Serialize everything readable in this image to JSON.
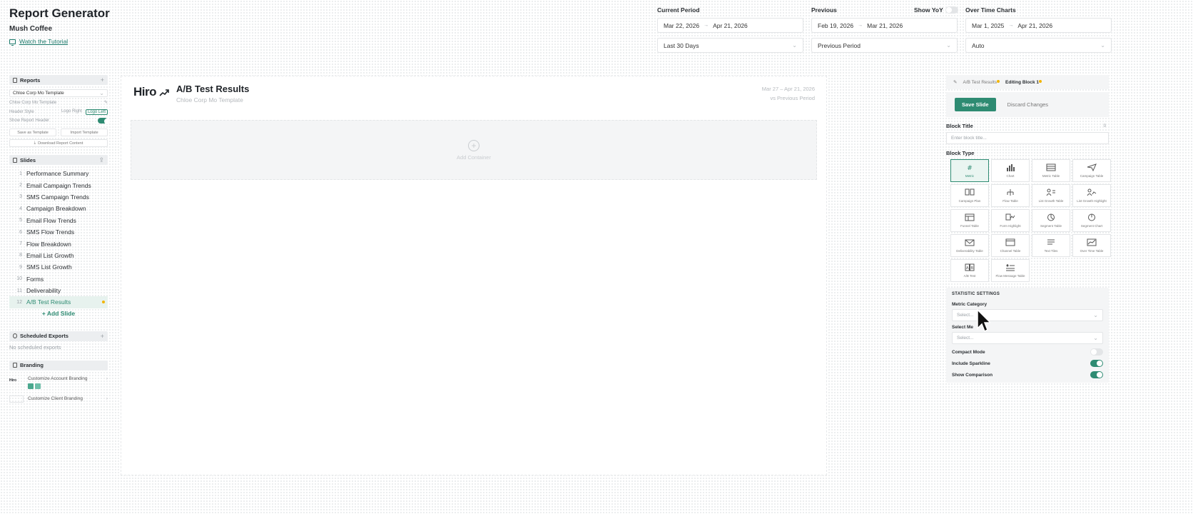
{
  "header": {
    "title": "Report Generator",
    "client": "Mush Coffee",
    "tutorial_link": "Watch the Tutorial"
  },
  "periods": {
    "current": {
      "label": "Current Period",
      "start": "Mar 22, 2026",
      "end": "Apr 21, 2026",
      "preset": "Last 30 Days"
    },
    "previous": {
      "label": "Previous",
      "yoy_label": "Show YoY",
      "yoy_on": false,
      "start": "Feb 19, 2026",
      "end": "Mar 21, 2026",
      "preset": "Previous Period"
    },
    "overtime": {
      "label": "Over Time Charts",
      "start": "Mar 1, 2025",
      "end": "Apr 21, 2026",
      "preset": "Auto"
    }
  },
  "sidebar": {
    "reports": {
      "title": "Reports",
      "template_select": "Chloe Corp Mo Template",
      "template_name": "Chloe Corp Mo Template",
      "header_style_label": "Header Style",
      "logo_right": "Logo Right",
      "logo_left": "Logo Left",
      "show_report_header_label": "Show Report Header",
      "save_template": "Save as Template",
      "import_template": "Import Template",
      "download": "Download Report Content"
    },
    "slides": {
      "title": "Slides",
      "items": [
        {
          "num": "1",
          "label": "Performance Summary"
        },
        {
          "num": "2",
          "label": "Email Campaign Trends"
        },
        {
          "num": "3",
          "label": "SMS Campaign Trends"
        },
        {
          "num": "4",
          "label": "Campaign Breakdown"
        },
        {
          "num": "5",
          "label": "Email Flow Trends"
        },
        {
          "num": "6",
          "label": "SMS Flow Trends"
        },
        {
          "num": "7",
          "label": "Flow Breakdown"
        },
        {
          "num": "8",
          "label": "Email List Growth"
        },
        {
          "num": "9",
          "label": "SMS List Growth"
        },
        {
          "num": "10",
          "label": "Forms"
        },
        {
          "num": "11",
          "label": "Deliverability"
        },
        {
          "num": "12",
          "label": "A/B Test Results"
        }
      ],
      "add_label": "+ Add Slide"
    },
    "scheduled": {
      "title": "Scheduled Exports",
      "empty": "No scheduled exports"
    },
    "branding": {
      "title": "Branding",
      "account": "Customize Account Branding",
      "client": "Customize Client Branding",
      "logo_text": "Hiro",
      "swatch_colors": [
        "#4aa88e",
        "#6fbfaa"
      ]
    }
  },
  "canvas": {
    "logo": "Hiro",
    "title": "A/B Test Results",
    "subtitle": "Chloe Corp Mo Template",
    "date_range": "Mar 27 – Apr 21, 2026",
    "comparison": "vs Previous Period",
    "add_container": "Add Container"
  },
  "editor": {
    "tab_slide": "A/B Test Results",
    "tab_block": "Editing Block 1",
    "save": "Save Slide",
    "discard": "Discard Changes",
    "block_title_label": "Block Title",
    "block_title_count": "0",
    "block_title_placeholder": "Enter block title...",
    "block_type_label": "Block Type",
    "block_types": [
      {
        "label": "Metric",
        "icon": "hash-icon"
      },
      {
        "label": "Chart",
        "icon": "bar-chart-icon"
      },
      {
        "label": "Metric Table",
        "icon": "table-icon"
      },
      {
        "label": "Campaign Table",
        "icon": "send-icon"
      },
      {
        "label": "Campaign Plan",
        "icon": "columns-icon"
      },
      {
        "label": "Flow Table",
        "icon": "flow-icon"
      },
      {
        "label": "List Growth Table",
        "icon": "users-list-icon"
      },
      {
        "label": "List Growth Highlight",
        "icon": "users-trend-icon"
      },
      {
        "label": "Funnel Table",
        "icon": "calendar-table-icon"
      },
      {
        "label": "Form Highlight",
        "icon": "form-trend-icon"
      },
      {
        "label": "Segment Table",
        "icon": "pie-icon"
      },
      {
        "label": "Segment Chart",
        "icon": "pie-chart-icon"
      },
      {
        "label": "Deliverability Table",
        "icon": "mail-icon"
      },
      {
        "label": "Channel Table",
        "icon": "window-icon"
      },
      {
        "label": "Text Tiles",
        "icon": "text-icon"
      },
      {
        "label": "Over Time Table",
        "icon": "line-chart-icon"
      },
      {
        "label": "A/B Test",
        "icon": "ab-icon"
      },
      {
        "label": "Flow Message Table",
        "icon": "flow-list-icon"
      }
    ],
    "stats": {
      "title": "STATISTIC SETTINGS",
      "metric_category_label": "Metric Category",
      "metric_category_value": "Select...",
      "select_metric_label": "Select Me",
      "select_metric_value": "Select...",
      "compact_label": "Compact Mode",
      "sparkline_label": "Include Sparkline",
      "comparison_label": "Show Comparison"
    }
  },
  "colors": {
    "accent": "#2e8b72",
    "badge": "#f2b400"
  }
}
